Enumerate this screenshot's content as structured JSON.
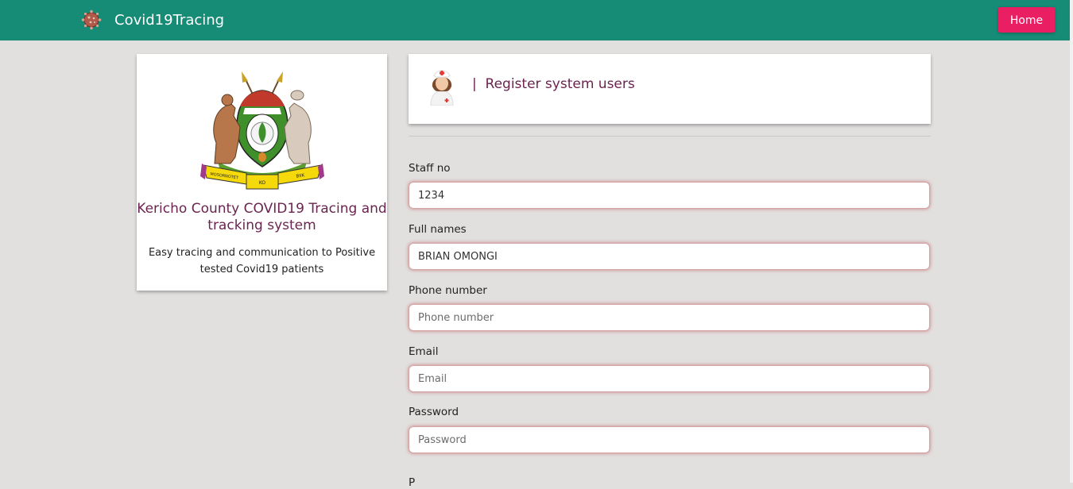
{
  "navbar": {
    "brand": "Covid19Tracing",
    "home_label": "Home"
  },
  "left_card": {
    "title": "Kericho County COVID19 Tracing and tracking system",
    "subtitle": "Easy tracing and communication to Positive tested Covid19 patients",
    "crest_text": {
      "left": "MOSORNOTET",
      "middle": "KO",
      "right": "BIIK"
    }
  },
  "header_card": {
    "title": "|  Register system users"
  },
  "form": {
    "staff_no": {
      "label": "Staff no",
      "value": "1234",
      "placeholder": "Staff no"
    },
    "full_names": {
      "label": "Full names",
      "value": "BRIAN OMONGI",
      "placeholder": "Full names"
    },
    "phone": {
      "label": "Phone number",
      "value": "",
      "placeholder": "Phone number"
    },
    "email": {
      "label": "Email",
      "value": "",
      "placeholder": "Email"
    },
    "password": {
      "label": "Password",
      "value": "",
      "placeholder": "Password"
    },
    "next_label_partial": "P"
  },
  "colors": {
    "navbar": "#168b76",
    "home_button": "#e91e63",
    "accent_text": "#6b2450",
    "background": "#e2e0df"
  },
  "icons": [
    "virus-icon",
    "county-crest-logo",
    "nurse-icon"
  ]
}
